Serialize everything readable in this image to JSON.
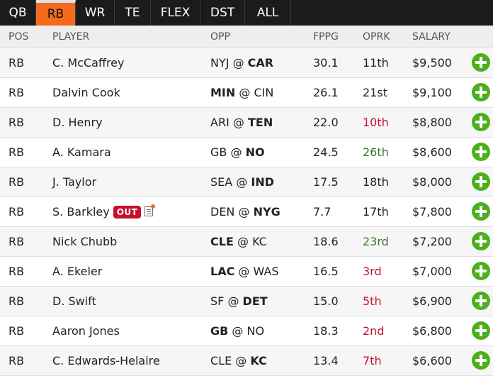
{
  "tabs": [
    "QB",
    "RB",
    "WR",
    "TE",
    "FLEX",
    "DST",
    "ALL"
  ],
  "active_tab": "RB",
  "columns": {
    "pos": "POS",
    "player": "PLAYER",
    "opp": "OPP",
    "fppg": "FPPG",
    "oprk": "OPRK",
    "salary": "SALARY"
  },
  "rows": [
    {
      "pos": "RB",
      "player": "C. McCaffrey",
      "opp_a": "NYJ",
      "opp_sep": "@",
      "opp_b": "CAR",
      "bold": "b",
      "fppg": "30.1",
      "oprk": "11th",
      "rank_color": "",
      "salary": "$9,500"
    },
    {
      "pos": "RB",
      "player": "Dalvin Cook",
      "opp_a": "MIN",
      "opp_sep": "@",
      "opp_b": "CIN",
      "bold": "a",
      "fppg": "26.1",
      "oprk": "21st",
      "rank_color": "",
      "salary": "$9,100"
    },
    {
      "pos": "RB",
      "player": "D. Henry",
      "opp_a": "ARI",
      "opp_sep": "@",
      "opp_b": "TEN",
      "bold": "b",
      "fppg": "22.0",
      "oprk": "10th",
      "rank_color": "red",
      "salary": "$8,800"
    },
    {
      "pos": "RB",
      "player": "A. Kamara",
      "opp_a": "GB",
      "opp_sep": "@",
      "opp_b": "NO",
      "bold": "b",
      "fppg": "24.5",
      "oprk": "26th",
      "rank_color": "green",
      "salary": "$8,600"
    },
    {
      "pos": "RB",
      "player": "J. Taylor",
      "opp_a": "SEA",
      "opp_sep": "@",
      "opp_b": "IND",
      "bold": "b",
      "fppg": "17.5",
      "oprk": "18th",
      "rank_color": "",
      "salary": "$8,000"
    },
    {
      "pos": "RB",
      "player": "S. Barkley",
      "status": "OUT",
      "has_note": true,
      "opp_a": "DEN",
      "opp_sep": "@",
      "opp_b": "NYG",
      "bold": "b",
      "fppg": "7.7",
      "oprk": "17th",
      "rank_color": "",
      "salary": "$7,800"
    },
    {
      "pos": "RB",
      "player": "Nick Chubb",
      "opp_a": "CLE",
      "opp_sep": "@",
      "opp_b": "KC",
      "bold": "a",
      "fppg": "18.6",
      "oprk": "23rd",
      "rank_color": "green",
      "salary": "$7,200"
    },
    {
      "pos": "RB",
      "player": "A. Ekeler",
      "opp_a": "LAC",
      "opp_sep": "@",
      "opp_b": "WAS",
      "bold": "a",
      "fppg": "16.5",
      "oprk": "3rd",
      "rank_color": "red",
      "salary": "$7,000"
    },
    {
      "pos": "RB",
      "player": "D. Swift",
      "opp_a": "SF",
      "opp_sep": "@",
      "opp_b": "DET",
      "bold": "b",
      "fppg": "15.0",
      "oprk": "5th",
      "rank_color": "red",
      "salary": "$6,900"
    },
    {
      "pos": "RB",
      "player": "Aaron Jones",
      "opp_a": "GB",
      "opp_sep": "@",
      "opp_b": "NO",
      "bold": "a",
      "fppg": "18.3",
      "oprk": "2nd",
      "rank_color": "red",
      "salary": "$6,800"
    },
    {
      "pos": "RB",
      "player": "C. Edwards-Helaire",
      "opp_a": "CLE",
      "opp_sep": "@",
      "opp_b": "KC",
      "bold": "b",
      "fppg": "13.4",
      "oprk": "7th",
      "rank_color": "red",
      "salary": "$6,600"
    }
  ],
  "colors": {
    "accent": "#f26a1b",
    "add": "#4caf1e",
    "rank_red": "#c8102e",
    "rank_green": "#2e7d1f",
    "out_badge": "#c8102e"
  },
  "icons": {
    "add": "plus-circle-icon",
    "note": "player-news-icon"
  }
}
